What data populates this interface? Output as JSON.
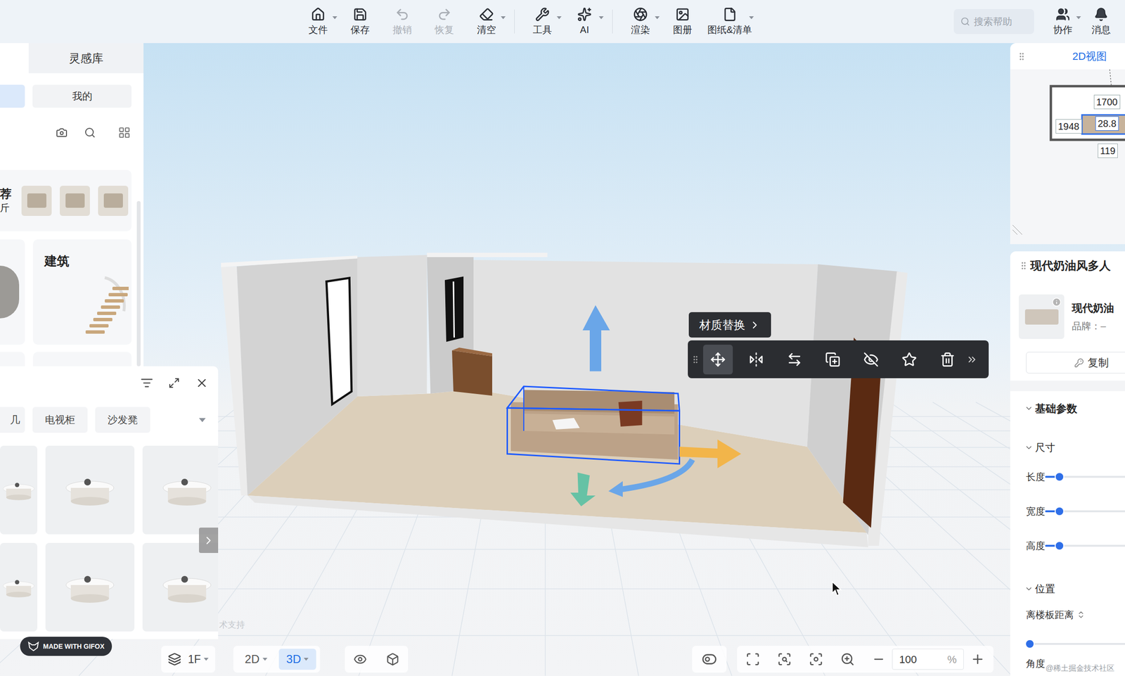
{
  "toolbar": {
    "items": [
      {
        "label": "文件",
        "disabled": false,
        "dropdown": true,
        "group": 1
      },
      {
        "label": "保存",
        "disabled": false,
        "dropdown": false,
        "group": 1
      },
      {
        "label": "撤销",
        "disabled": true,
        "dropdown": false,
        "group": 1
      },
      {
        "label": "恢复",
        "disabled": true,
        "dropdown": false,
        "group": 1
      },
      {
        "label": "清空",
        "disabled": false,
        "dropdown": true,
        "group": 1
      },
      {
        "label": "工具",
        "disabled": false,
        "dropdown": true,
        "group": 2
      },
      {
        "label": "AI",
        "disabled": false,
        "dropdown": true,
        "group": 2
      },
      {
        "label": "渲染",
        "disabled": false,
        "dropdown": true,
        "group": 3
      },
      {
        "label": "图册",
        "disabled": false,
        "dropdown": false,
        "group": 3
      },
      {
        "label": "图纸&清单",
        "disabled": false,
        "dropdown": true,
        "group": 3
      }
    ],
    "search": {
      "placeholder": "搜索帮助"
    },
    "user": [
      {
        "label": "协作",
        "dropdown": true
      },
      {
        "label": "消息",
        "dropdown": false
      }
    ]
  },
  "library": {
    "tab": {
      "label": "灵感库",
      "selected": false
    },
    "subtab": {
      "label": "我的",
      "selected": false
    },
    "featured": [
      "荐",
      "斤"
    ],
    "card": "建筑"
  },
  "furniture": {
    "categories": [
      {
        "label": "几",
        "selected": false
      },
      {
        "label": "电视柜",
        "selected": false
      },
      {
        "label": "沙发凳",
        "selected": false
      }
    ]
  },
  "canvas": {
    "tooltip": "材质替换",
    "tools": [
      {
        "selected": true
      },
      {
        "selected": false
      },
      {
        "selected": false
      },
      {
        "selected": false
      },
      {
        "selected": false
      },
      {
        "selected": false
      },
      {
        "selected": false
      }
    ],
    "footer_text": "术支持",
    "gifox": "MADE WITH GIFOX",
    "watermark": "@稀土掘金技术社区",
    "object_selected": true
  },
  "plan": {
    "title": "2D视图",
    "dimensions": [
      "1700",
      "1948",
      "28.8",
      "119"
    ]
  },
  "properties": {
    "title": "现代奶油风多人",
    "product": {
      "name": "现代奶油",
      "brand": "品牌：–"
    },
    "copy_button": "复制",
    "sections": [
      {
        "label": "基础参数",
        "expanded": true,
        "kind": "heading",
        "fields": []
      },
      {
        "label": "尺寸",
        "expanded": true,
        "kind": "group",
        "fields": [
          {
            "label": "长度",
            "level": 0.1,
            "kind": "inline"
          },
          {
            "label": "宽度",
            "level": 0.1,
            "kind": "inline"
          },
          {
            "label": "高度",
            "level": 0.1,
            "kind": "inline"
          }
        ]
      },
      {
        "label": "位置",
        "expanded": true,
        "kind": "group",
        "fields": [
          {
            "label": "离楼板距离",
            "level": 0,
            "kind": "stacked"
          },
          {
            "label": "角度",
            "level": 0,
            "kind": "label"
          }
        ]
      }
    ]
  },
  "bottom": {
    "floor": "1F",
    "views": [
      {
        "label": "2D",
        "selected": false
      },
      {
        "label": "3D",
        "selected": true
      }
    ],
    "zoom": {
      "value": "100",
      "unit": "%"
    }
  }
}
